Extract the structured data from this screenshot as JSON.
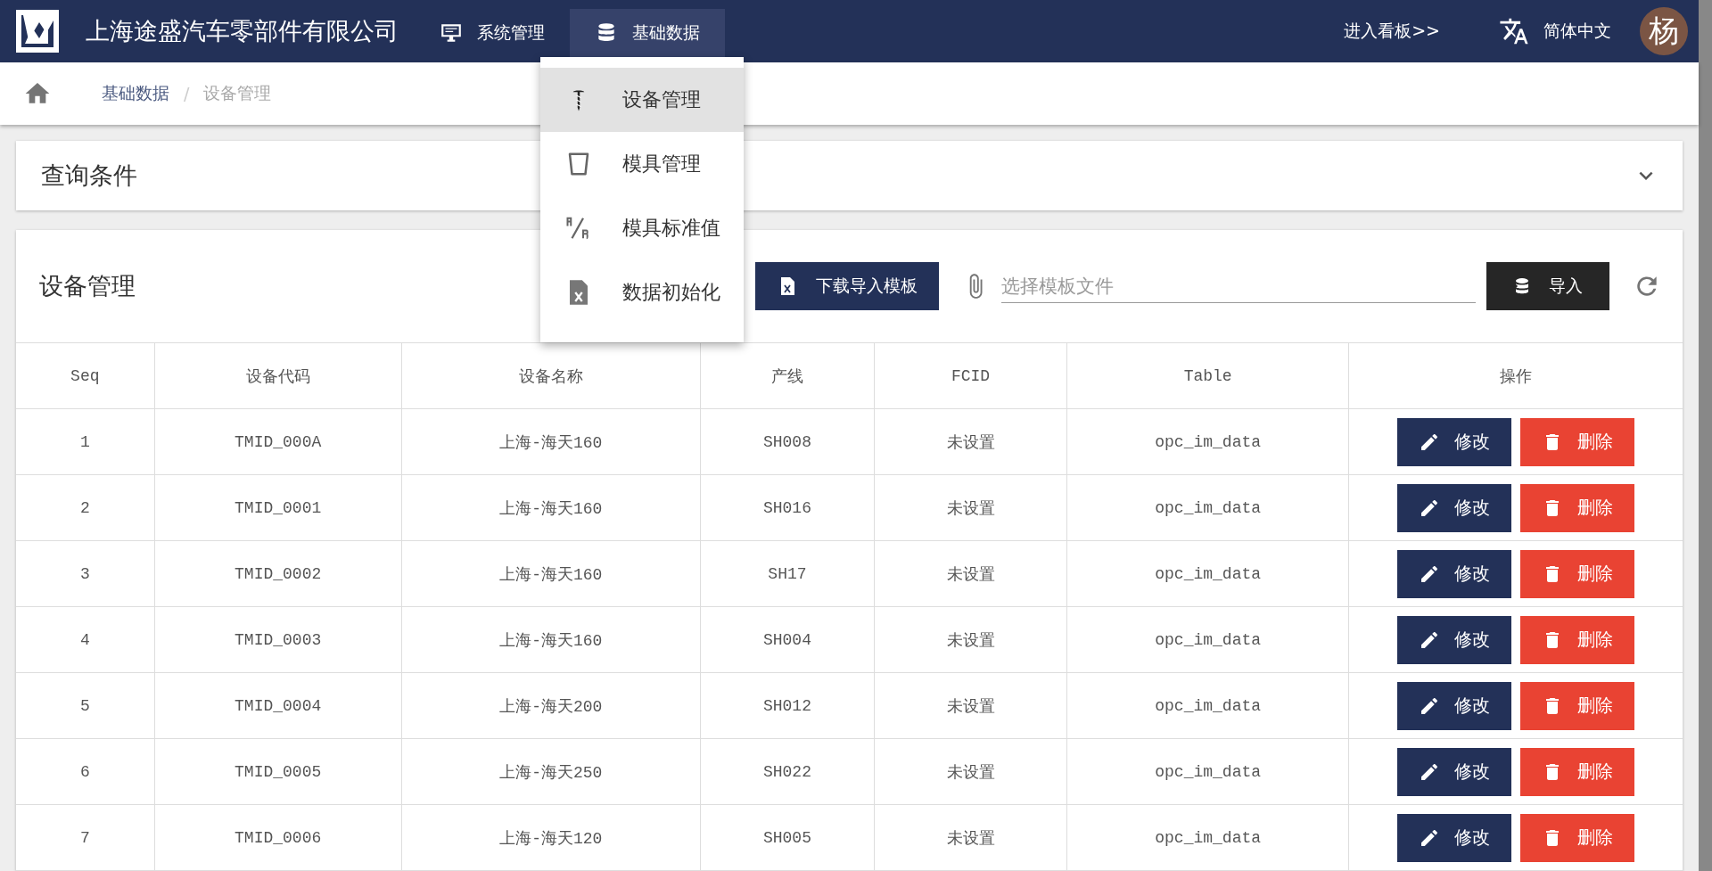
{
  "header": {
    "company_name": "上海途盛汽车零部件有限公司",
    "nav": [
      {
        "label": "系统管理",
        "selected": false
      },
      {
        "label": "基础数据",
        "selected": true
      }
    ],
    "dashboard_link": "进入看板>>",
    "language": "简体中文",
    "avatar": "杨"
  },
  "dropdown": {
    "items": [
      {
        "label": "设备管理",
        "selected": true
      },
      {
        "label": "模具管理",
        "selected": false
      },
      {
        "label": "模具标准值",
        "selected": false
      },
      {
        "label": "数据初始化",
        "selected": false
      }
    ]
  },
  "breadcrumb_separator": "/",
  "breadcrumb": [
    {
      "label": "基础数据",
      "current": false
    },
    {
      "label": "设备管理",
      "current": true
    }
  ],
  "query_panel": {
    "title": "查询条件",
    "expanded": false
  },
  "device_panel": {
    "title": "设备管理",
    "download_button": "下载导入模板",
    "file_field": {
      "placeholder": "选择模板文件"
    },
    "import_button": "导入"
  },
  "table": {
    "columns": [
      "Seq",
      "设备代码",
      "设备名称",
      "产线",
      "FCID",
      "Table",
      "操作"
    ],
    "rows": [
      {
        "cells": [
          "1",
          "TMID_000A",
          "上海-海天160",
          "SH008",
          "未设置",
          "opc_im_data"
        ],
        "edit": "修改",
        "delete": "删除"
      },
      {
        "cells": [
          "2",
          "TMID_0001",
          "上海-海天160",
          "SH016",
          "未设置",
          "opc_im_data"
        ],
        "edit": "修改",
        "delete": "删除"
      },
      {
        "cells": [
          "3",
          "TMID_0002",
          "上海-海天160",
          "SH17",
          "未设置",
          "opc_im_data"
        ],
        "edit": "修改",
        "delete": "删除"
      },
      {
        "cells": [
          "4",
          "TMID_0003",
          "上海-海天160",
          "SH004",
          "未设置",
          "opc_im_data"
        ],
        "edit": "修改",
        "delete": "删除"
      },
      {
        "cells": [
          "5",
          "TMID_0004",
          "上海-海天200",
          "SH012",
          "未设置",
          "opc_im_data"
        ],
        "edit": "修改",
        "delete": "删除"
      },
      {
        "cells": [
          "6",
          "TMID_0005",
          "上海-海天250",
          "SH022",
          "未设置",
          "opc_im_data"
        ],
        "edit": "修改",
        "delete": "删除"
      },
      {
        "cells": [
          "7",
          "TMID_0006",
          "上海-海天120",
          "SH005",
          "未设置",
          "opc_im_data"
        ],
        "edit": "修改",
        "delete": "删除"
      }
    ]
  }
}
